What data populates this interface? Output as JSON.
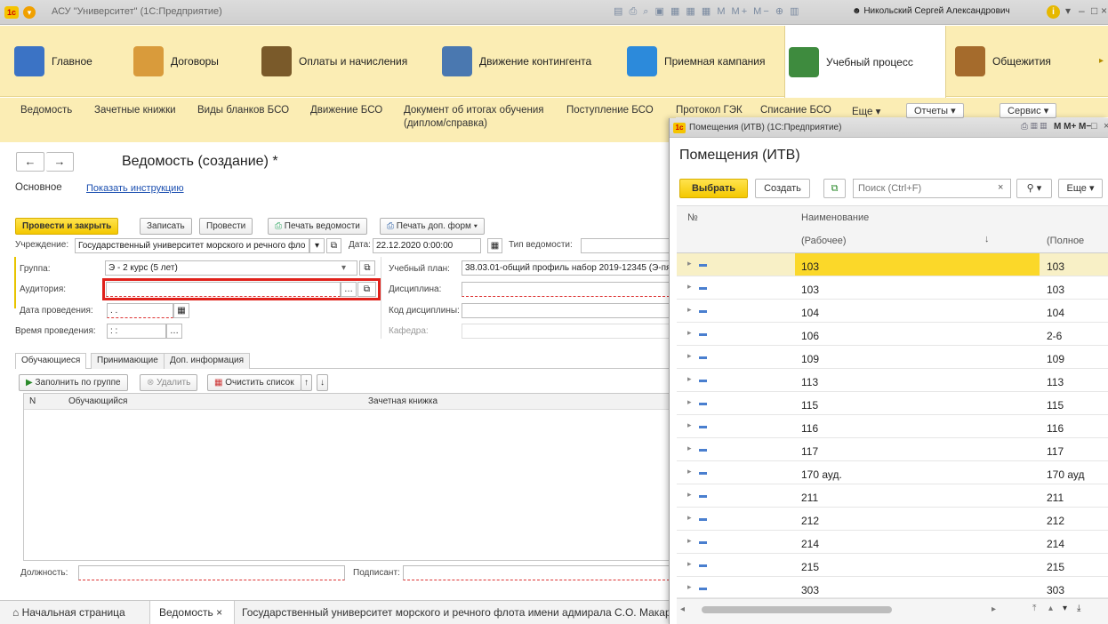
{
  "app": {
    "title": "АСУ \"Университет\" (1С:Предприятие)",
    "logo_text": "1с",
    "user": "Никольский Сергей Александрович",
    "toolbar_glyphs": "▤ ⎙ ⌕ ▣ ▦ ▦ ▦ M M+ M− ⊕ ▥"
  },
  "sections": [
    {
      "label": "Главное",
      "color": "#3b73c5"
    },
    {
      "label": "Договоры",
      "color": "#d99b3b"
    },
    {
      "label": "Оплаты и начисления",
      "color": "#7a5a2a"
    },
    {
      "label": "Движение контингента",
      "color": "#4a78b0"
    },
    {
      "label": "Приемная кампания",
      "color": "#2c8adb"
    },
    {
      "label": "Учебный процесс",
      "color": "#3e8b3e"
    },
    {
      "label": "Общежития",
      "color": "#a56b2c"
    }
  ],
  "commands": {
    "items": [
      "Ведомость",
      "Зачетные книжки",
      "Виды бланков БСО",
      "Движение БСО",
      "Документ об итогах обучения",
      "(диплом/справка)",
      "Поступление БСО",
      "Протокол ГЭК",
      "Списание БСО",
      "Еще ▾",
      "Отчеты ▾",
      "Сервис ▾"
    ]
  },
  "form": {
    "title": "Ведомость (создание) *",
    "tab_main": "Основное",
    "link_instruction": "Показать инструкцию",
    "btn_post_close": "Провести и закрыть",
    "btn_save": "Записать",
    "btn_post": "Провести",
    "btn_print": "Печать ведомости",
    "btn_print_more": "Печать доп. форм ▾",
    "lbl_institution": "Учреждение:",
    "institution": "Государственный университет морского и речного фло",
    "lbl_date": "Дата:",
    "date": "22.12.2020  0:00:00",
    "lbl_type": "Тип ведомости:",
    "lbl_group": "Группа:",
    "group": "Э - 2 курс (5 лет)",
    "lbl_plan": "Учебный план:",
    "plan": "38.03.01-общий профиль набор 2019-12345 (Э-пя",
    "lbl_room": "Аудитория:",
    "lbl_discipline": "Дисциплина:",
    "lbl_date_held": "Дата проведения:",
    "date_held": " . .",
    "lbl_disc_code": "Код дисциплины:",
    "lbl_time_held": "Время проведения:",
    "time_held": " : :",
    "lbl_dept": "Кафедра:",
    "tabs": [
      "Обучающиеся",
      "Принимающие",
      "Доп. информация"
    ],
    "btn_fill": "Заполнить по группе",
    "btn_delete": "Удалить",
    "btn_clear": "Очистить список",
    "col_n": "N",
    "col_student": "Обучающийся",
    "col_book": "Зачетная книжка",
    "lbl_position": "Должность:",
    "lbl_signer": "Подписант:"
  },
  "popup": {
    "window_title": "Помещения (ИТВ) (1С:Предприятие)",
    "heading": "Помещения (ИТВ)",
    "btn_select": "Выбрать",
    "btn_create": "Создать",
    "search_placeholder": "Поиск (Ctrl+F)",
    "btn_more": "Еще ▾",
    "col_no": "№",
    "col_name": "Наименование",
    "col_working": "(Рабочее)",
    "col_full": "(Полное",
    "rows": [
      {
        "name": "103",
        "full": "103"
      },
      {
        "name": "103",
        "full": "103"
      },
      {
        "name": "104",
        "full": "104"
      },
      {
        "name": "106",
        "full": "2-6"
      },
      {
        "name": "109",
        "full": "109"
      },
      {
        "name": "113",
        "full": "113"
      },
      {
        "name": "115",
        "full": "115"
      },
      {
        "name": "116",
        "full": "116"
      },
      {
        "name": "117",
        "full": "117"
      },
      {
        "name": "170 ауд.",
        "full": "170 ауд"
      },
      {
        "name": "211",
        "full": "211"
      },
      {
        "name": "212",
        "full": "212"
      },
      {
        "name": "214",
        "full": "214"
      },
      {
        "name": "215",
        "full": "215"
      },
      {
        "name": "303",
        "full": "303"
      }
    ],
    "selected_index": 0
  },
  "bottom": {
    "home": "Начальная страница",
    "tab1": "Ведомость ×",
    "tab2": "Государственный университет морского и речного флота имени адмирала С.О. Макар"
  },
  "colors": {
    "accent": "#f4c800",
    "highlight": "#e0211b",
    "link": "#1a4eb0"
  }
}
